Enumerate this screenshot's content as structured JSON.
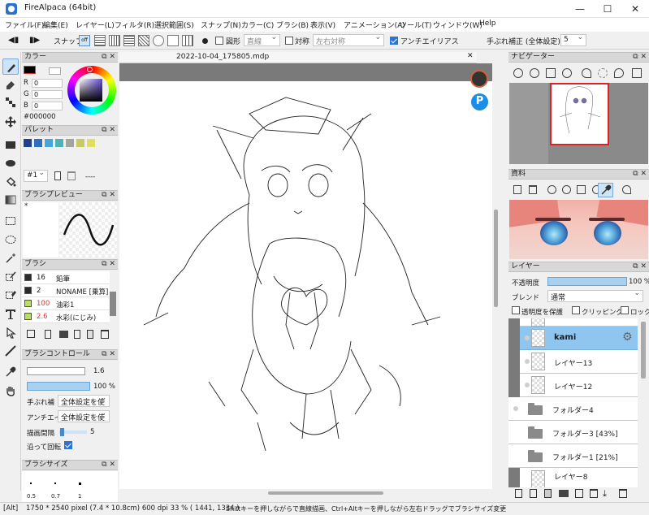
{
  "window": {
    "title": "FireAlpaca (64bit)"
  },
  "menu": [
    "ファイル(F)",
    "編集(E)",
    "レイヤー(L)",
    "フィルタ(R)",
    "選択範囲(S)",
    "スナップ(N)",
    "カラー(C)",
    "ブラシ(B)",
    "表示(V)",
    "アニメーション(A)",
    "ツール(T)",
    "ウィンドウ(W)",
    "Help"
  ],
  "toolbar": {
    "snap_label": "スナップ",
    "snap_off": "off",
    "shape_label": "図形",
    "shape_value": "直線",
    "symmetry_label": "対称",
    "symmetry_value": "左右対称",
    "antialias_label": "アンチエイリアス",
    "antialias_checked": true,
    "stabilizer_label": "手ぶれ補正 (全体設定)",
    "stabilizer_value": "5"
  },
  "color_panel": {
    "title": "カラー",
    "r": "0",
    "g": "0",
    "b": "0",
    "r_label": "R",
    "g_label": "G",
    "b_label": "B",
    "hex": "#000000"
  },
  "palette_panel": {
    "title": "パレット",
    "swatches": [
      "#1f3f8f",
      "#2f6fc0",
      "#49a4da",
      "#52b0b8",
      "#a3a3a3",
      "#c9c966",
      "#e0e060"
    ],
    "page": "#1",
    "dashes": "----"
  },
  "brush_preview": {
    "title": "ブラシプレビュー",
    "marker": "*"
  },
  "brush_panel": {
    "title": "ブラシ",
    "items": [
      {
        "size": "16",
        "name": "鉛筆",
        "size_color": "#1a1a1a",
        "swatch": "#2a2a2a"
      },
      {
        "size": "2",
        "name": "NONAME [乗算]",
        "size_color": "#1a1a1a",
        "swatch": "#2a2a2a"
      },
      {
        "size": "100",
        "name": "油彩1",
        "size_color": "#d23a3a",
        "swatch": "#b8e05a"
      },
      {
        "size": "2.6",
        "name": "水彩(にじみ)",
        "size_color": "#d23a3a",
        "swatch": "#b8e05a"
      }
    ]
  },
  "brush_control": {
    "title": "ブラシコントロール",
    "size_value": "1.6",
    "opacity_value": "100 %",
    "stabilizer_label": "手ぶれ補",
    "stabilizer_value": "全体設定を使",
    "antialias_label": "アンチエイ",
    "antialias_value": "全体設定を使",
    "interval_label": "描画間隔",
    "interval_value": "5",
    "rotate_label": "沿って回転"
  },
  "brush_size": {
    "title": "ブラシサイズ",
    "sizes": [
      "0.5",
      "0.7",
      "1"
    ]
  },
  "document": {
    "tab_title": "2022-10-04_175805.mdp"
  },
  "navigator": {
    "title": "ナビゲーター"
  },
  "reference": {
    "title": "資料"
  },
  "layers": {
    "title": "レイヤー",
    "opacity_label": "不透明度",
    "opacity_value": "100 %",
    "blend_label": "ブレンド",
    "blend_value": "通常",
    "protect_alpha": "透明度を保護",
    "clipping": "クリッピング",
    "lock": "ロック",
    "rows": [
      {
        "name": "",
        "kind": "layer"
      },
      {
        "name": "kami",
        "kind": "layer",
        "selected": true
      },
      {
        "name": "レイヤー13",
        "kind": "layer"
      },
      {
        "name": "レイヤー12",
        "kind": "layer"
      },
      {
        "name": "フォルダー4",
        "kind": "folder"
      },
      {
        "name": "フォルダー3 [43%]",
        "kind": "folder"
      },
      {
        "name": "フォルダー1 [21%]",
        "kind": "folder"
      },
      {
        "name": "レイヤー8",
        "kind": "layer"
      }
    ]
  },
  "status": {
    "prefix": "[Alt]",
    "size": "1750 * 2540 pixel  (7.4 * 10.8cm)  600 dpi  33 %  ( 1441, 1334 )",
    "hint": "Shiftキーを押しながらで直線描画、Ctrl+Altキーを押しながら左右ドラッグでブラシサイズ変更"
  },
  "colors": {
    "accent": "#2a73d9",
    "selection": "#8fc6f0",
    "canvas_bg": "#7a7a7a"
  }
}
